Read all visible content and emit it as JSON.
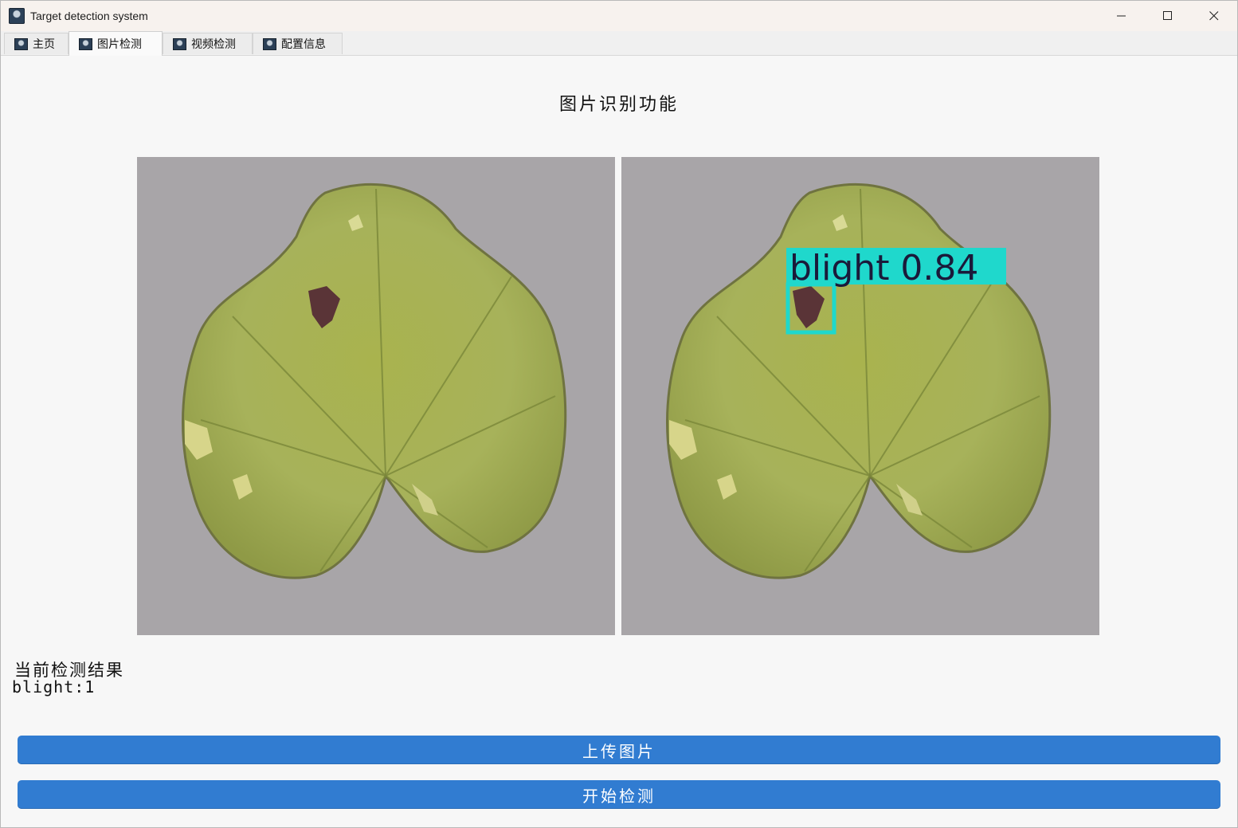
{
  "window": {
    "title": "Target detection system",
    "controls": [
      "minimize-icon",
      "maximize-icon",
      "close-icon"
    ]
  },
  "tabs": [
    {
      "label": "主页",
      "icon": "app-icon",
      "active": false
    },
    {
      "label": "图片检测",
      "icon": "app-icon",
      "active": true
    },
    {
      "label": "视频检测",
      "icon": "app-icon",
      "active": false
    },
    {
      "label": "配置信息",
      "icon": "app-icon",
      "active": false
    }
  ],
  "main": {
    "title": "图片识别功能",
    "detection": {
      "label": "blight 0.84",
      "box_color": "#1fd8cc"
    },
    "result_heading": "当前检测结果",
    "result_value": "blight:1",
    "upload_button": "上传图片",
    "detect_button": "开始检测"
  },
  "colors": {
    "accent": "#317cd1",
    "detection_box": "#1fd8cc"
  }
}
